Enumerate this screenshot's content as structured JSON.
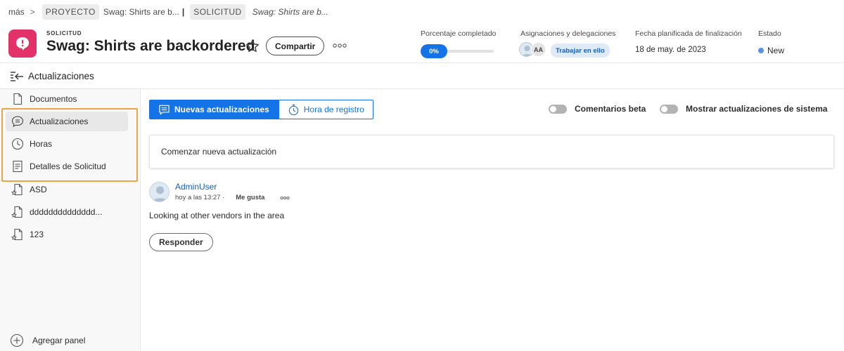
{
  "breadcrumb": {
    "more": "más",
    "separator": ">",
    "project_chip": "PROYECTO",
    "project_name": "Swag: Shirts are b...",
    "divider": "|",
    "request_chip": "SOLICITUD",
    "request_name": "Swag: Shirts are b..."
  },
  "header": {
    "object_type": "SOLICITUD",
    "title": "Swag: Shirts are backordered",
    "share_label": "Compartir",
    "progress_label": "Porcentaje completado",
    "progress_value": "0%",
    "progress_fraction": 0,
    "assign_label": "Asignaciones y delegaciones",
    "assignee_initials": "AA",
    "work_on_it_label": "Trabajar en ello",
    "due_label": "Fecha planificada de finalización",
    "due_value": "18 de may. de 2023",
    "status_label": "Estado",
    "status_value": "New",
    "status_color": "#5a92e6",
    "brand_color": "#e3316a"
  },
  "updates_bar": {
    "label": "Actualizaciones"
  },
  "sidebar": {
    "items": [
      {
        "label": "Documentos",
        "icon": "document-icon"
      },
      {
        "label": "Actualizaciones",
        "icon": "comment-icon"
      },
      {
        "label": "Horas",
        "icon": "clock-icon"
      },
      {
        "label": "Detalles de Solicitud",
        "icon": "details-icon"
      },
      {
        "label": "ASD",
        "icon": "custom-form-icon"
      },
      {
        "label": "dddddddddddddd...",
        "icon": "custom-form-icon"
      },
      {
        "label": "123",
        "icon": "custom-form-icon"
      }
    ],
    "add_panel": "Agregar panel"
  },
  "main": {
    "tabs": {
      "new_updates": "Nuevas actualizaciones",
      "log_time": "Hora de registro"
    },
    "toggles": {
      "beta_comments": "Comentarios beta",
      "system_updates": "Mostrar actualizaciones de sistema"
    },
    "new_update_placeholder": "Comenzar nueva actualización",
    "post": {
      "user": "AdminUser",
      "time": "hoy a las 13:27 ·",
      "like": "Me gusta",
      "body": "Looking at other vendors in the area",
      "reply": "Responder"
    },
    "accent_color": "#1473e6",
    "highlight_color": "#f0a246"
  }
}
